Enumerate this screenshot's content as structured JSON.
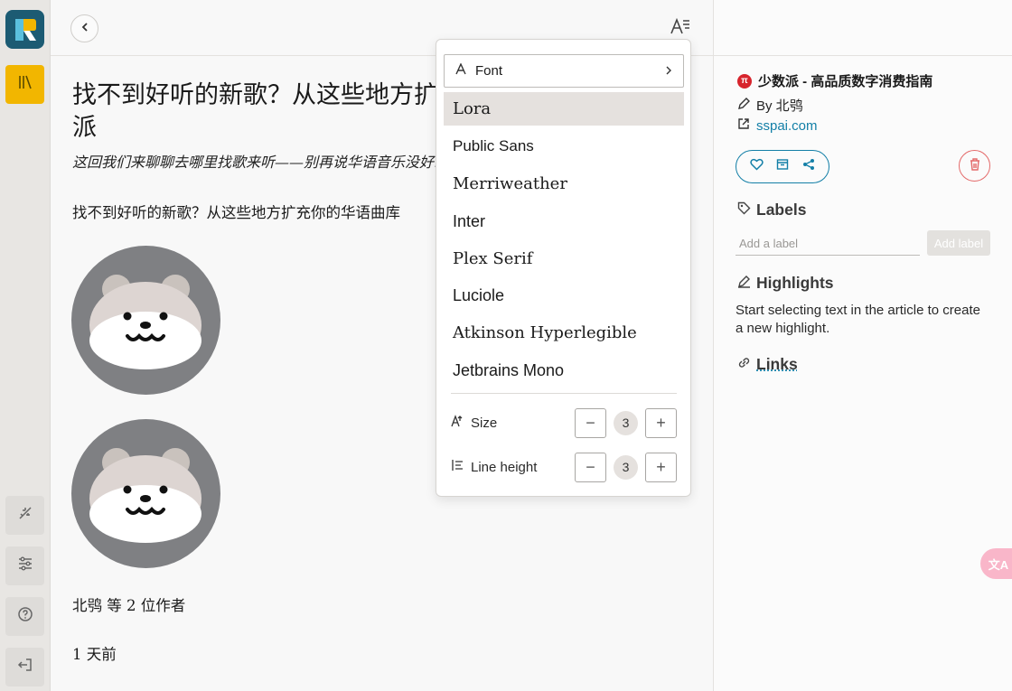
{
  "sidebar": {
    "icons": [
      "logo-icon",
      "library-icon",
      "sparkle-off-icon",
      "sliders-icon",
      "help-icon",
      "logout-icon"
    ]
  },
  "article": {
    "title": "找不到好听的新歌？从这些地方扩充你的华语曲库 - 少数派",
    "subtitle": "这回我们来聊聊去哪里找歌来听——别再说华语音乐没好歌了。",
    "paragraph": "找不到好听的新歌？从这些地方扩充你的华语曲库",
    "authors": "北鸮 等 2 位作者",
    "time": "1 天前"
  },
  "font_menu": {
    "header_label": "Font",
    "fonts": [
      "Lora",
      "Public Sans",
      "Merriweather",
      "Inter",
      "Plex Serif",
      "Luciole",
      "Atkinson Hyperlegible",
      "Jetbrains Mono"
    ],
    "selected_font": "Lora",
    "size_label": "Size",
    "size_value": "3",
    "line_height_label": "Line height",
    "line_height_value": "3",
    "minus": "−",
    "plus": "+"
  },
  "panel": {
    "site_icon_text": "π",
    "site_name": "少数派 - 高品质数字消费指南",
    "by_line": "By 北鸮",
    "url": "sspai.com",
    "labels_heading": "Labels",
    "label_placeholder": "Add a label",
    "add_label_button": "Add label",
    "highlights_heading": "Highlights",
    "highlights_text": "Start selecting text in the article to create a new highlight.",
    "links_heading": "Links"
  },
  "translate_fab": "文A",
  "colors": {
    "accent": "#137fa7",
    "library_active": "#f2b600",
    "delete": "#e46a6a",
    "logo": "#1c5b73"
  }
}
